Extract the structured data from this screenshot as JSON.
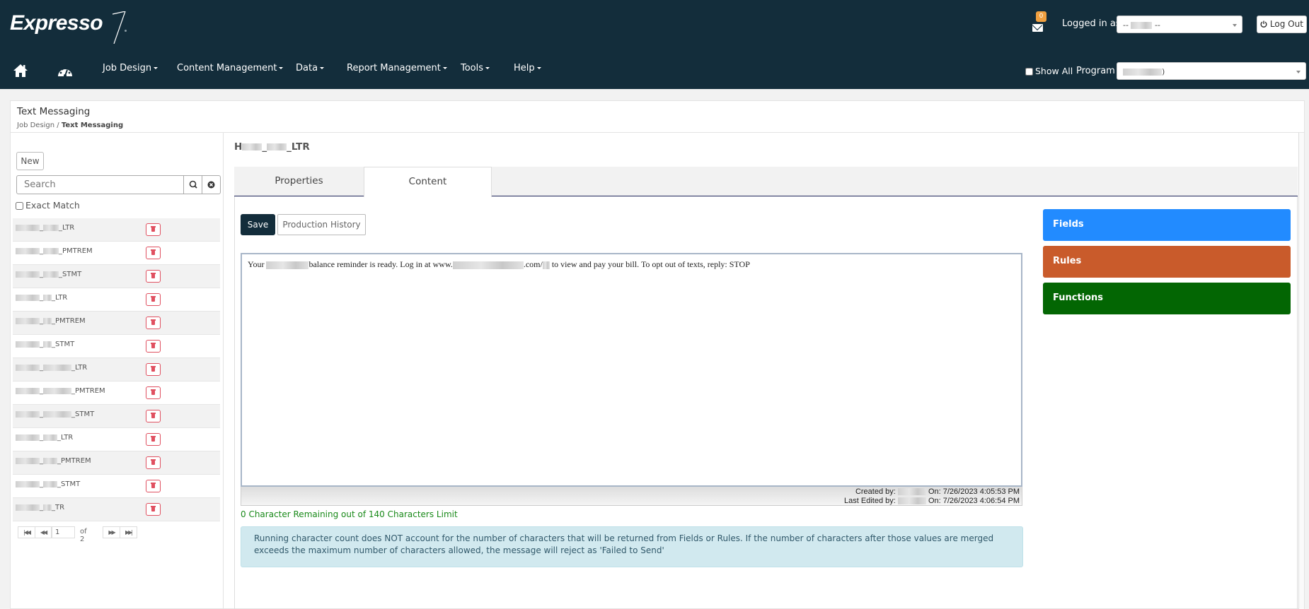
{
  "app": {
    "logo": "Expresso",
    "mail_count": "0",
    "logged_in_label": "Logged in as",
    "logged_in_user_prefix": "--",
    "logged_in_user_suffix": "--",
    "logout_label": "Log Out",
    "show_all_label": "Show All",
    "show_all_checked": false,
    "program_label": "Program",
    "program_value_suffix": ")"
  },
  "nav": {
    "items": [
      {
        "label": "Job Design"
      },
      {
        "label": "Content Management"
      },
      {
        "label": "Data"
      },
      {
        "label": "Report Management"
      },
      {
        "label": "Tools"
      },
      {
        "label": "Help"
      }
    ]
  },
  "page": {
    "title": "Text Messaging",
    "breadcrumb_parent": "Job Design",
    "breadcrumb_sep": " / ",
    "breadcrumb_current": "Text Messaging"
  },
  "left": {
    "new_label": "New",
    "search_placeholder": "Search",
    "exact_match_label": "Exact Match",
    "items": [
      {
        "suffix": "_LTR"
      },
      {
        "suffix": "_PMTREM"
      },
      {
        "suffix": "_STMT"
      },
      {
        "suffix": "_LTR"
      },
      {
        "suffix": "_PMTREM"
      },
      {
        "suffix": "_STMT"
      },
      {
        "suffix": "_LTR"
      },
      {
        "suffix": "_PMTREM"
      },
      {
        "suffix": "_STMT"
      },
      {
        "suffix": "_LTR"
      },
      {
        "suffix": "_PMTREM"
      },
      {
        "suffix": "_STMT"
      },
      {
        "suffix": "TR"
      }
    ],
    "pager": {
      "current": "1",
      "of_label": "of 2"
    }
  },
  "record": {
    "title_prefix": "H",
    "title_suffix": "_LTR",
    "tabs": [
      {
        "label": "Properties",
        "active": false
      },
      {
        "label": "Content",
        "active": true
      }
    ],
    "save_label": "Save",
    "history_label": "Production History",
    "message": {
      "part1": "Your ",
      "part2": "balance reminder is ready. Log in at www.",
      "part3": ".com/",
      "part4": " to view and pay your bill. To opt out of texts, reply: STOP"
    },
    "created_label": "Created by:",
    "created_on": "On: 7/26/2023 4:05:53 PM",
    "edited_label": "Last Edited by:",
    "edited_on": "On: 7/26/2023 4:06:54 PM",
    "remaining": "0 Character Remaining out of 140 Characters Limit",
    "alert": "Running character count does NOT account for the number of characters that will be returned from Fields or Rules. If the number of characters after those values are merged exceeds the maximum number of characters allowed, the message will reject as 'Failed to Send'"
  },
  "side_buttons": [
    {
      "label": "Fields",
      "color": "#228bff"
    },
    {
      "label": "Rules",
      "color": "#c95b2b"
    },
    {
      "label": "Functions",
      "color": "#036603"
    }
  ],
  "colors": {
    "header_bg": "#132d3b",
    "delete_red": "#e05060",
    "remaining_green": "#1a8a1a",
    "alert_bg": "#d1e9ef"
  }
}
